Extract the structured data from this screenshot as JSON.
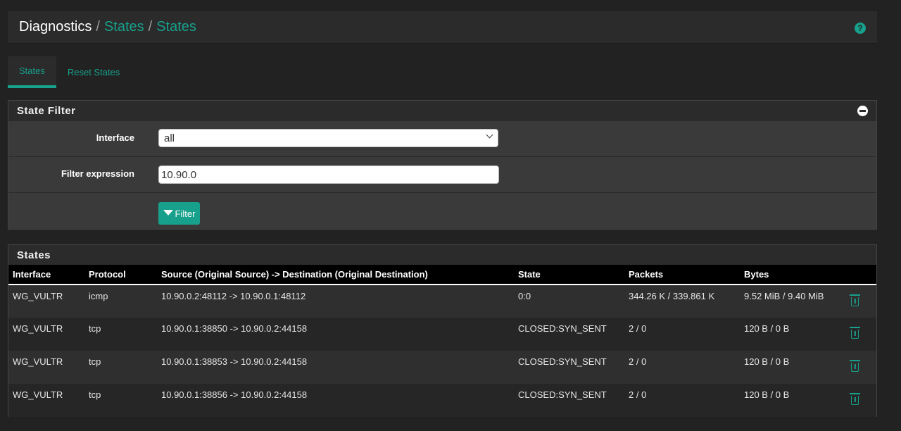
{
  "breadcrumb": {
    "root": "Diagnostics",
    "sep": "/",
    "items": [
      "States",
      "States"
    ]
  },
  "help_icon": "?",
  "tabs": [
    {
      "label": "States",
      "active": true
    },
    {
      "label": "Reset States",
      "active": false
    }
  ],
  "filter_panel": {
    "title": "State Filter",
    "interface_label": "Interface",
    "interface_value": "all",
    "expression_label": "Filter expression",
    "expression_value": "10.90.0",
    "button_label": "Filter"
  },
  "states_panel": {
    "title": "States",
    "columns": [
      "Interface",
      "Protocol",
      "Source (Original Source) -> Destination (Original Destination)",
      "State",
      "Packets",
      "Bytes"
    ],
    "rows": [
      {
        "interface": "WG_VULTR",
        "protocol": "icmp",
        "route": "10.90.0.2:48112 -> 10.90.0.1:48112",
        "state": "0:0",
        "packets": "344.26 K / 339.861 K",
        "bytes": "9.52 MiB / 9.40 MiB"
      },
      {
        "interface": "WG_VULTR",
        "protocol": "tcp",
        "route": "10.90.0.1:38850 -> 10.90.0.2:44158",
        "state": "CLOSED:SYN_SENT",
        "packets": "2 / 0",
        "bytes": "120 B / 0 B"
      },
      {
        "interface": "WG_VULTR",
        "protocol": "tcp",
        "route": "10.90.0.1:38853 -> 10.90.0.2:44158",
        "state": "CLOSED:SYN_SENT",
        "packets": "2 / 0",
        "bytes": "120 B / 0 B"
      },
      {
        "interface": "WG_VULTR",
        "protocol": "tcp",
        "route": "10.90.0.1:38856 -> 10.90.0.2:44158",
        "state": "CLOSED:SYN_SENT",
        "packets": "2 / 0",
        "bytes": "120 B / 0 B"
      }
    ]
  },
  "colors": {
    "accent": "#17a08b",
    "background": "#222222",
    "panel": "#3a3a3a"
  }
}
